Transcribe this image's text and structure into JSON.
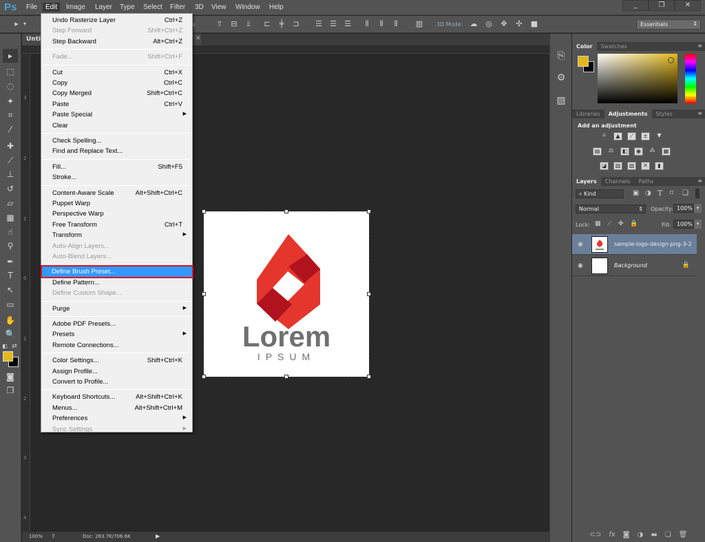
{
  "app": {
    "logo": "Ps"
  },
  "menubar": {
    "items": [
      "File",
      "Edit",
      "Image",
      "Layer",
      "Type",
      "Select",
      "Filter",
      "3D",
      "View",
      "Window",
      "Help"
    ],
    "open": "Edit"
  },
  "window_controls": {
    "minimize": "_",
    "restore": "❐",
    "close": "✕"
  },
  "options_bar": {
    "mode_3d_label": "3D Mode:",
    "workspace": "Essentials",
    "truncated_label": "ols"
  },
  "document": {
    "tab_title": "Untitled",
    "zoom": "100%",
    "doc_info": "Doc: 263.7K/706.6K",
    "ruler_left_numbers": [
      "3",
      "2",
      "1",
      "0",
      "1",
      "2",
      "3",
      "4"
    ]
  },
  "canvas_logo": {
    "word": "Lorem",
    "sub": "IPSUM",
    "primary_red": "#e4362d",
    "dark_red": "#b0131e",
    "text_gray": "#707070"
  },
  "edit_menu": {
    "items": [
      {
        "label": "Undo Rasterize Layer",
        "shortcut": "Ctrl+Z",
        "disabled": false
      },
      {
        "label": "Step Forward",
        "shortcut": "Shift+Ctrl+Z",
        "disabled": true
      },
      {
        "label": "Step Backward",
        "shortcut": "Alt+Ctrl+Z",
        "disabled": false
      },
      {
        "sep": true
      },
      {
        "label": "Fade...",
        "shortcut": "Shift+Ctrl+F",
        "disabled": true
      },
      {
        "sep": true
      },
      {
        "label": "Cut",
        "shortcut": "Ctrl+X",
        "disabled": false
      },
      {
        "label": "Copy",
        "shortcut": "Ctrl+C",
        "disabled": false
      },
      {
        "label": "Copy Merged",
        "shortcut": "Shift+Ctrl+C",
        "disabled": false
      },
      {
        "label": "Paste",
        "shortcut": "Ctrl+V",
        "disabled": false
      },
      {
        "label": "Paste Special",
        "submenu": true,
        "disabled": false
      },
      {
        "label": "Clear",
        "disabled": false
      },
      {
        "sep": true
      },
      {
        "label": "Check Spelling...",
        "disabled": false
      },
      {
        "label": "Find and Replace Text...",
        "disabled": false
      },
      {
        "sep": true
      },
      {
        "label": "Fill...",
        "shortcut": "Shift+F5",
        "disabled": false
      },
      {
        "label": "Stroke...",
        "disabled": false
      },
      {
        "sep": true
      },
      {
        "label": "Content-Aware Scale",
        "shortcut": "Alt+Shift+Ctrl+C",
        "disabled": false
      },
      {
        "label": "Puppet Warp",
        "disabled": false
      },
      {
        "label": "Perspective Warp",
        "disabled": false
      },
      {
        "label": "Free Transform",
        "shortcut": "Ctrl+T",
        "disabled": false
      },
      {
        "label": "Transform",
        "submenu": true,
        "disabled": false
      },
      {
        "label": "Auto-Align Layers...",
        "disabled": true
      },
      {
        "label": "Auto-Blend Layers...",
        "disabled": true
      },
      {
        "sep": true
      },
      {
        "label": "Define Brush Preset...",
        "disabled": false,
        "highlighted": true
      },
      {
        "label": "Define Pattern...",
        "disabled": false
      },
      {
        "label": "Define Custom Shape...",
        "disabled": true
      },
      {
        "sep": true
      },
      {
        "label": "Purge",
        "submenu": true,
        "disabled": false
      },
      {
        "sep": true
      },
      {
        "label": "Adobe PDF Presets...",
        "disabled": false
      },
      {
        "label": "Presets",
        "submenu": true,
        "disabled": false
      },
      {
        "label": "Remote Connections...",
        "disabled": false
      },
      {
        "sep": true
      },
      {
        "label": "Color Settings...",
        "shortcut": "Shift+Ctrl+K",
        "disabled": false
      },
      {
        "label": "Assign Profile...",
        "disabled": false
      },
      {
        "label": "Convert to Profile...",
        "disabled": false
      },
      {
        "sep": true
      },
      {
        "label": "Keyboard Shortcuts...",
        "shortcut": "Alt+Shift+Ctrl+K",
        "disabled": false
      },
      {
        "label": "Menus...",
        "shortcut": "Alt+Shift+Ctrl+M",
        "disabled": false
      },
      {
        "label": "Preferences",
        "submenu": true,
        "disabled": false
      },
      {
        "label": "Sync Settings",
        "submenu": true,
        "disabled": true
      }
    ]
  },
  "color_panel": {
    "tabs": [
      "Color",
      "Swatches"
    ],
    "active": "Color",
    "foreground": "#e2b81b",
    "background": "#000000"
  },
  "adjustments_panel": {
    "tabs": [
      "Libraries",
      "Adjustments",
      "Styles"
    ],
    "active": "Adjustments",
    "title": "Add an adjustment"
  },
  "layers_panel": {
    "tabs": [
      "Layers",
      "Channels",
      "Paths"
    ],
    "active": "Layers",
    "filter": "Kind",
    "blend_mode": "Normal",
    "opacity_label": "Opacity:",
    "opacity": "100%",
    "lock_label": "Lock:",
    "fill_label": "Fill:",
    "fill": "100%",
    "layers": [
      {
        "name": "sample-logo-design-png-3-2",
        "selected": true,
        "locked": false
      },
      {
        "name": "Background",
        "selected": false,
        "locked": true
      }
    ]
  },
  "icons": {
    "eye": "👁",
    "lock": "🔒",
    "submenu": "▶",
    "menu": "≡"
  }
}
